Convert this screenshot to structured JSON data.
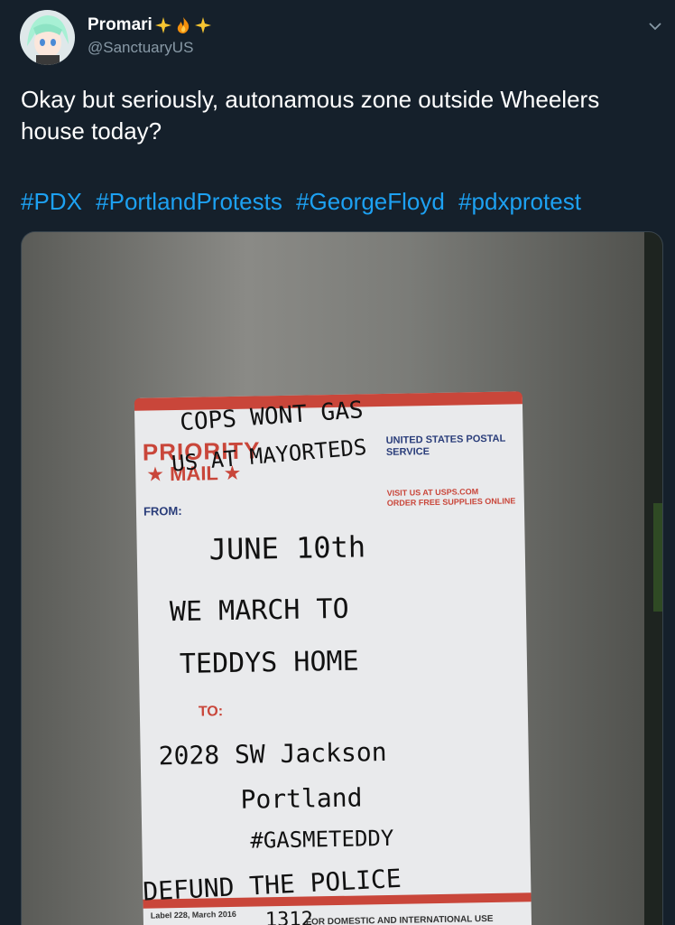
{
  "user": {
    "display_name": "Promari",
    "handle": "@SanctuaryUS",
    "emoji_icons": [
      "sparkles-icon",
      "fire-icon",
      "sparkles-icon"
    ]
  },
  "tweet": {
    "text": "Okay but seriously, autonamous zone outside Wheelers house today?",
    "hashtags": [
      "#PDX",
      "#PortlandProtests",
      "#GeorgeFloyd",
      "#pdxprotest"
    ]
  },
  "photo": {
    "printed": {
      "priority": "PRIORITY",
      "mail": "★ MAIL ★",
      "usps": "UNITED STATES POSTAL SERVICE",
      "usps_url": "VISIT US AT USPS.COM",
      "order": "ORDER FREE SUPPLIES ONLINE",
      "from": "FROM:",
      "to": "TO:",
      "label_no": "Label 228, March 2016",
      "domestic": "FOR DOMESTIC AND INTERNATIONAL USE"
    },
    "handwriting": {
      "line1": "COPS WONT GAS",
      "line2": "US AT MAYORTEDS",
      "line3": "JUNE 10th",
      "line4": "WE MARCH TO",
      "line5": "TEDDYS HOME",
      "line6": "2028 SW Jackson",
      "line7": "Portland",
      "line8": "#GASMETEDDY",
      "line9": "DEFUND THE POLICE",
      "line10": "1312"
    }
  },
  "colors": {
    "background": "#15202b",
    "link": "#1da1f2",
    "secondary": "#8899a6"
  }
}
